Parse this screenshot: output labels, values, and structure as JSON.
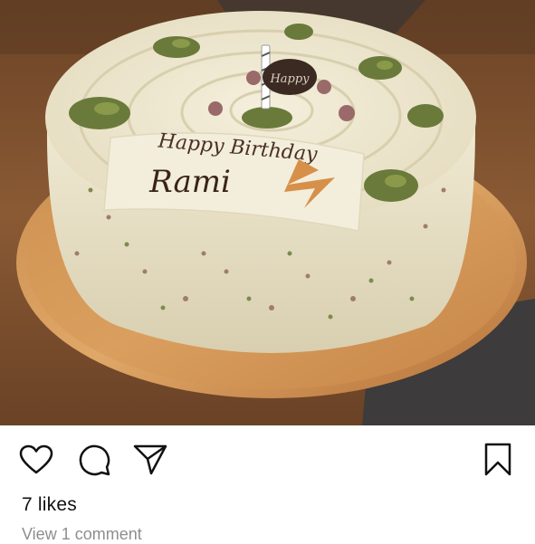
{
  "post": {
    "image_alt": "Cake photo",
    "cake_inscription_line1": "Happy Birthday",
    "cake_inscription_line2": "Rami",
    "cake_topper": "Happy"
  },
  "actions": {
    "like_icon": "heart-icon",
    "comment_icon": "comment-bubble-icon",
    "share_icon": "paper-plane-icon",
    "save_icon": "bookmark-icon"
  },
  "likes_text": "7 likes",
  "comments_text": "View 1 comment"
}
